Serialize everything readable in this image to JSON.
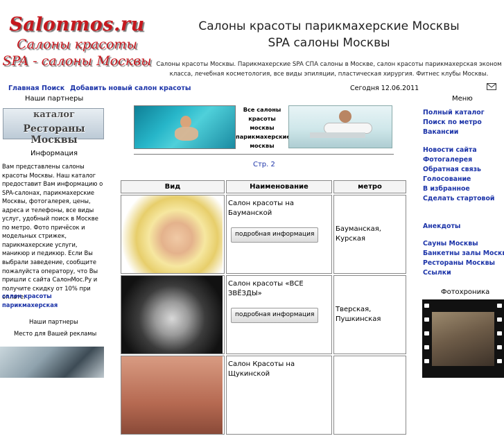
{
  "logo": {
    "line1": "Salonmos.ru",
    "line2": "Салоны красоты",
    "line3": "SPA - салоны Москвы"
  },
  "header": {
    "title_line1": "Салоны красоты парикмахерские Москвы",
    "title_line2": "SPA салоны Москвы",
    "description": "Салоны красоты Москвы. Парикмахерские SPA СПА салоны в Москве, салон красоты парикмахерская эконом класса, лечебная косметология, все виды эпиляции, пластическая хирургия. Фитнес клубы Москвы."
  },
  "nav": {
    "home": "Главная",
    "search": "Поиск",
    "add": "Добавить новый салон красоты",
    "date": "Сегодня 12.06.2011",
    "menu_title": "Меню"
  },
  "left": {
    "partners_title": "Наши партнеры",
    "partner_banner": {
      "line1": "каталог",
      "line2": "Рестораны Москвы"
    },
    "info_title": "Информация",
    "info_text": "Вам представлены салоны красоты Москвы. Наш каталог предоставит Вам информацию о SPA-салонах, парикмахерские Москвы, фотогалерея, цены, адреса и телефоны, все виды услуг, удобный поиск в Москве по метро. Фото причёсок и модельных стрижек, парикмахерские услуги, маникюр и педикюр. Если Вы выбрали заведение, сообщите пожалуйста оператору, что Вы пришли с сайта СалонМос.Ру и получите скидку от 10% при оплате.",
    "link1": "салон красоты",
    "link2": "парикмахерская",
    "partners_title2": "Наши партнеры",
    "ad_place": "Место для Вашей рекламы"
  },
  "center": {
    "promo_text": "Все салоны красоты москвы парикмахерские москвы",
    "page_label": "Стр. 2",
    "columns": [
      "Вид",
      "Наименование",
      "метро"
    ],
    "rows": [
      {
        "name": "Салон красоты на Бауманской",
        "button": "подробная информация",
        "metro": "Бауманская, Курская"
      },
      {
        "name": "Салон красоты «ВСЕ ЗВЁЗДЫ»",
        "button": "подробная информация",
        "metro": "Тверская, Пушкинская"
      },
      {
        "name": "Салон Красоты на Щукинской",
        "button": "",
        "metro": ""
      }
    ]
  },
  "menu": {
    "items": [
      "Полный каталог",
      "Поиск по метро",
      "Вакансии",
      "Новости сайта",
      "Фотогалерея",
      "Обратная связь",
      "Голосование",
      "В избранное",
      "Сделать стартовой",
      "Анекдоты",
      "Сауны Москвы",
      "Банкетны залы Москвы",
      "Рестораны Москвы",
      "Ссылки"
    ],
    "photo_title": "Фотохроника"
  },
  "colors": {
    "logo_red": "#c5181e",
    "link_blue": "#1b33a8"
  }
}
